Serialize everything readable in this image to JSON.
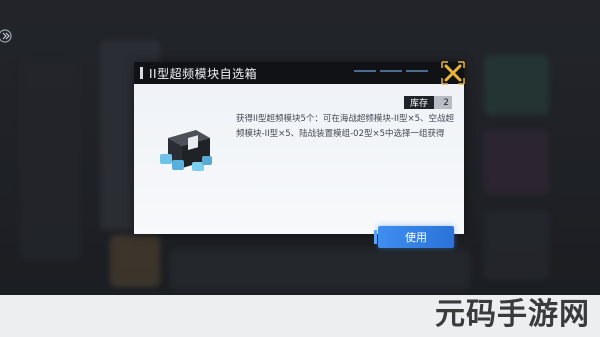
{
  "dialog": {
    "title": "II型超频模块自选箱",
    "stock_label": "库存",
    "stock_count": "2",
    "description": "获得II型超频模块5个：可在海战超频模块-II型×5、空战超频模块-II型×5、陆战装置模组-02型×5中选择一组获得",
    "use_label": "使用"
  },
  "watermark": "元码手游网",
  "colors": {
    "header": "#101216",
    "accent_blue": "#3f8ef0",
    "close_gold": "#e7b53c"
  },
  "icons": {
    "close": "close-x-icon",
    "item": "module-box-icon",
    "edge": "chevron-right-icon"
  }
}
